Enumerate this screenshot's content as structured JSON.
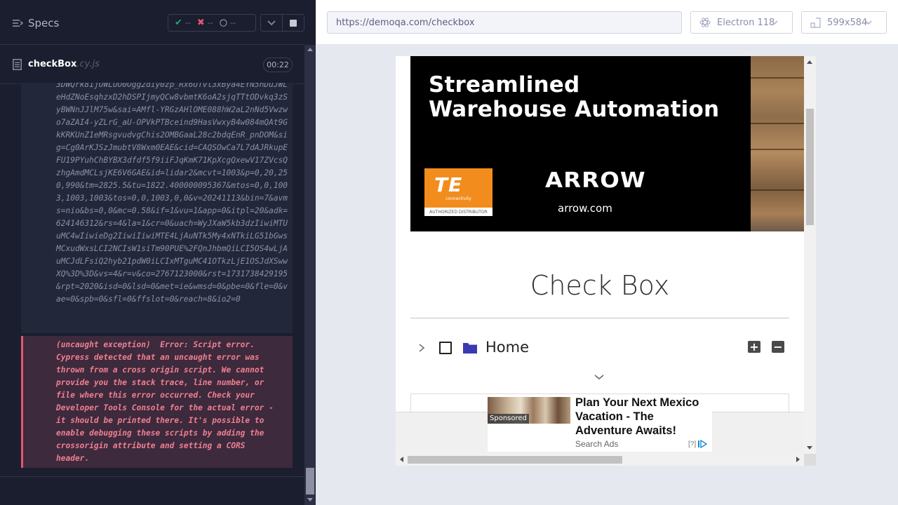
{
  "reporter": {
    "specs_label": "Specs",
    "stats": {
      "passed": "--",
      "failed": "--",
      "pending": "--"
    },
    "spec": {
      "name": "checkBox",
      "ext": ".cy.js",
      "duration": "00:22"
    },
    "url_log": "3DWQrk81jOWLUO0Ogg2diy0zp_Rx6UTvl3xBya4EYN5hDuJWLeHdZNoEsqhzxD2hDSPIjmyQCw8vbmtK6oA2sjqTTtODvkq3zSyBWNnJJlM75w&sai=AMfl-YRGzAHlOME088hW2aL2nNd5Vwzwo7aZAI4-yZLrG_aU-OPVkPTBceind9HasVwxyB4w084mQAt9GkKRKUnZ1eMRsgvudvgChis2OMBGaaL28c2bdqEnR_pnDOM&sig=Cg0ArKJSzJmubtV8Wxm0EAE&cid=CAQSOwCa7L7dAJRkupEFU19PYuhChBYBX3dfdf5f9iiFJqKmK71KpXcgQxewV17ZVcsQzhgAmdMCLsjKE6V6GAE&id=lidar2&mcvt=1003&p=0,20,250,990&tm=2825.5&tu=1822.400000095367&mtos=0,0,1003,1003,1003&tos=0,0,1003,0,0&v=20241113&bin=7&avms=nio&bs=0,0&mc=0.58&if=1&vu=1&app=0&itpl=20&adk=624146312&rs=4&la=1&cr=0&uach=WyJXaW5kb3dzIiwiMTUuMC4wIiwieDg2IiwiIiwiMTE4LjAuNTk5My4xNTkiLG51bGwsMCxudWxsLCI2NCIsW1siTm90PUE%2FQnJhbmQiLCI5OS4wLjAuMCJdLFsiQ2hyb21pdW0iLCIxMTguMC41OTkzLjE1OSJdXSwwXQ%3D%3D&vs=4&r=v&co=2767123000&rst=1731738429195&rpt=2020&isd=0&lsd=0&met=ie&wmsd=0&pbe=0&fle=0&vae=0&spb=0&sfl=0&ffslot=0&reach=8&io2=0",
    "error_log": "(uncaught exception)  Error: Script error.\nCypress detected that an uncaught error was\nthrown from a cross origin script. We cannot\nprovide you the stack trace, line number, or\nfile where this error occurred. Check your\nDeveloper Tools Console for the actual error -\nit should be printed there. It's possible to\nenable debugging these scripts by adding the\ncrossorigin attribute and setting a CORS\nheader."
  },
  "aut": {
    "url": "https://demoqa.com/checkbox",
    "browser": "Electron 118",
    "viewport": "599x584"
  },
  "page": {
    "banner": {
      "title": "Streamlined Warehouse Automation",
      "te_logo": "TE",
      "te_sub": "connectivity",
      "te_badge": "AUTHORIZED DISTRIBUTOR",
      "arrow_logo": "ARROW",
      "arrow_url": "arrow.com"
    },
    "title": "Check Box",
    "tree": {
      "label": "Home",
      "expand": "+",
      "collapse": "−"
    },
    "ad": {
      "sponsored": "Sponsored",
      "headline": "Plan Your Next Mexico Vacation - The Adventure Awaits!",
      "search": "Search Ads",
      "choice": "[?]"
    }
  },
  "colors": {
    "reporter_bg": "#1b1e2e",
    "pass": "#1fa971",
    "fail": "#e45770",
    "error_text": "#f07f93",
    "folder": "#3a39b0",
    "te_orange": "#f28d1d"
  },
  "icons": {
    "specs": "list-icon",
    "file": "file-icon",
    "browser": "electron-icon",
    "viewport": "viewport-icon",
    "tree_toggle": "chevron-right-icon",
    "tree_folder": "folder-icon"
  }
}
